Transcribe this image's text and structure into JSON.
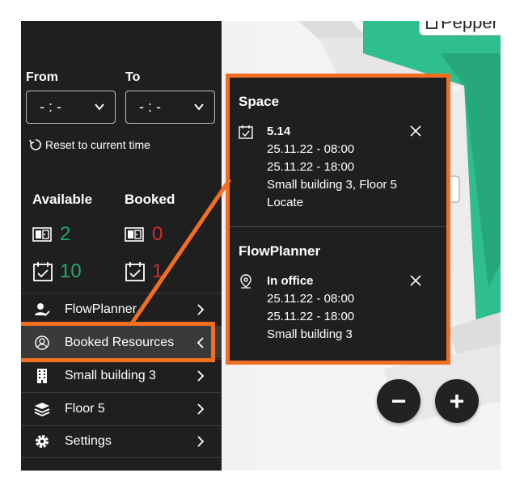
{
  "map": {
    "pepper_label": "Pepper",
    "zoom_out_label": "−",
    "zoom_in_label": "+"
  },
  "sidebar": {
    "from_label": "From",
    "to_label": "To",
    "from_value": "- : -",
    "to_value": "- : -",
    "reset_label": "Reset to current time",
    "available_label": "Available",
    "booked_label": "Booked",
    "available_rooms": "2",
    "booked_rooms": "0",
    "available_desks": "10",
    "booked_desks": "1",
    "menu": [
      {
        "label": "FlowPlanner",
        "icon": "person-check-icon"
      },
      {
        "label": "Booked Resources",
        "icon": "bookmark-circle-icon"
      },
      {
        "label": "Small building 3",
        "icon": "building-icon"
      },
      {
        "label": "Floor 5",
        "icon": "layers-icon"
      },
      {
        "label": "Settings",
        "icon": "gear-icon"
      }
    ]
  },
  "popover": {
    "space": {
      "title": "Space",
      "name": "5.14",
      "start": "25.11.22 - 08:00",
      "end": "25.11.22 - 18:00",
      "location": "Small building 3, Floor 5",
      "locate": "Locate"
    },
    "flowplanner": {
      "title": "FlowPlanner",
      "status": "In office",
      "start": "25.11.22 - 08:00",
      "end": "25.11.22 - 18:00",
      "location": "Small building 3"
    }
  },
  "colors": {
    "accent_orange": "#f26f21",
    "available_green": "#24a86a",
    "booked_red": "#d62a2a",
    "panel_dark": "#1f1f1f",
    "map_green": "#2fbf8d"
  }
}
